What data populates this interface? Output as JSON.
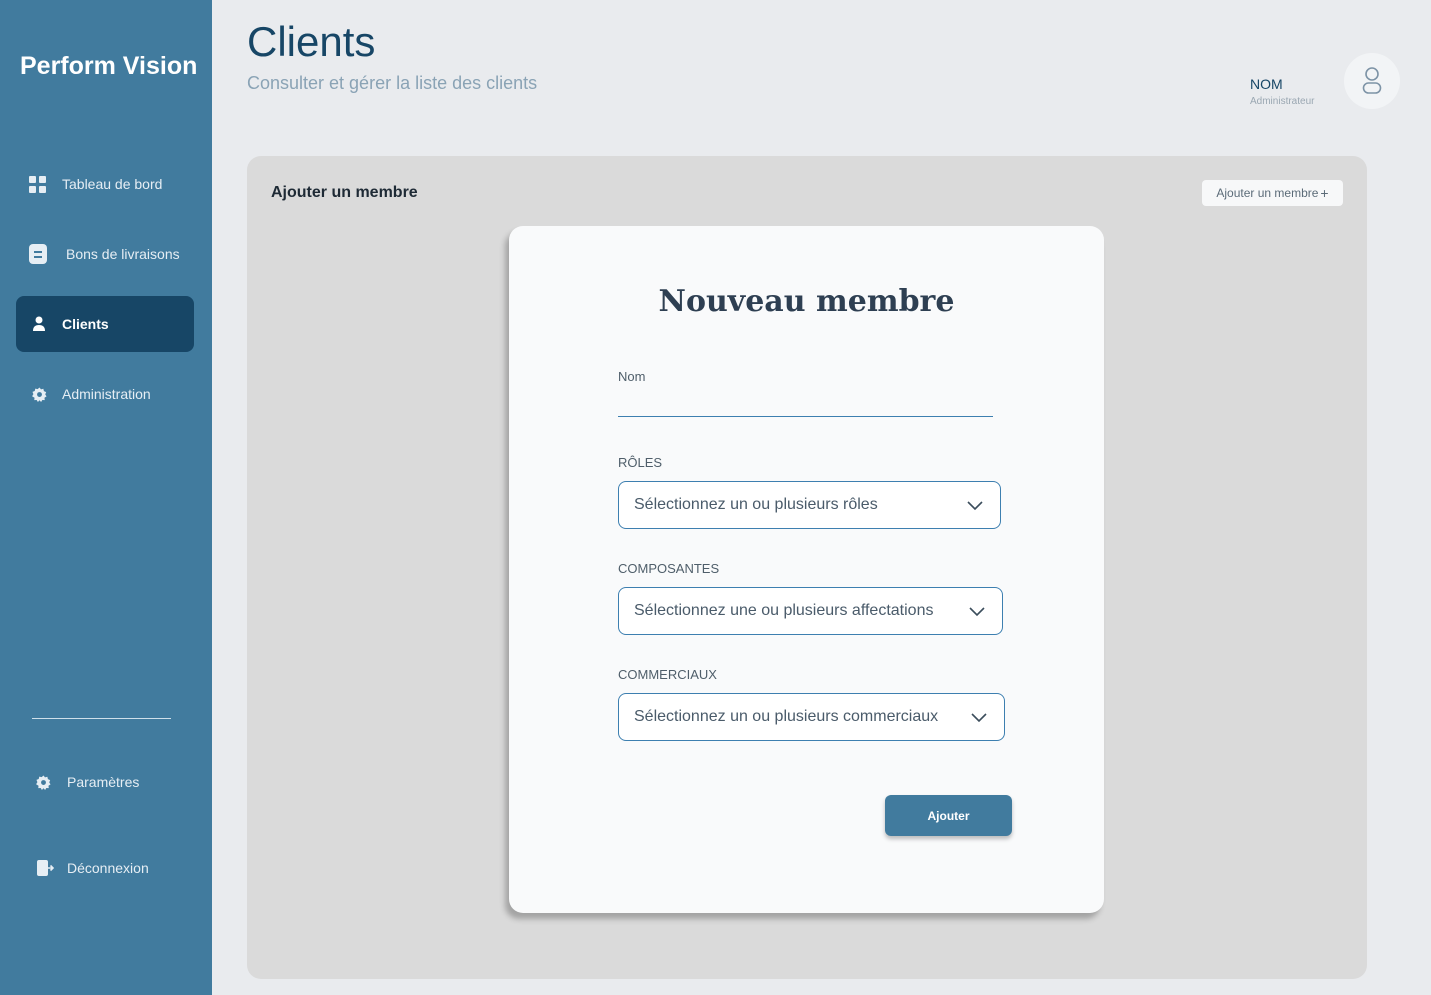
{
  "sidebar": {
    "brand": "Perform Vision",
    "nav": [
      {
        "label": "Tableau de bord",
        "icon": "dashboard-icon"
      },
      {
        "label": "Bons de livraisons",
        "icon": "document-icon"
      },
      {
        "label": "Clients",
        "icon": "user-icon",
        "active": true
      },
      {
        "label": "Administration",
        "icon": "gear-icon"
      }
    ],
    "bottom": [
      {
        "label": "Paramètres",
        "icon": "gear-icon"
      },
      {
        "label": "Déconnexion",
        "icon": "logout-icon"
      }
    ]
  },
  "header": {
    "title": "Clients",
    "subtitle": "Consulter et gérer la liste des clients",
    "user_name": "NOM",
    "user_role": "Administrateur"
  },
  "panel": {
    "title": "Ajouter un membre",
    "add_button": "Ajouter un membre",
    "add_symbol": "+"
  },
  "modal": {
    "title": "Nouveau membre",
    "name_label": "Nom",
    "name_value": "",
    "roles_label": "RÔLES",
    "roles_placeholder": "Sélectionnez un ou plusieurs rôles",
    "components_label": "COMPOSANTES",
    "components_placeholder": "Sélectionnez une ou plusieurs affectations",
    "sales_label": "COMMERCIAUX",
    "sales_placeholder": "Sélectionnez un ou plusieurs commerciaux",
    "submit_label": "Ajouter"
  },
  "colors": {
    "sidebar": "#417b9e",
    "sidebar_active": "#174666",
    "accent": "#3d7fb0",
    "panel": "#dadada"
  }
}
